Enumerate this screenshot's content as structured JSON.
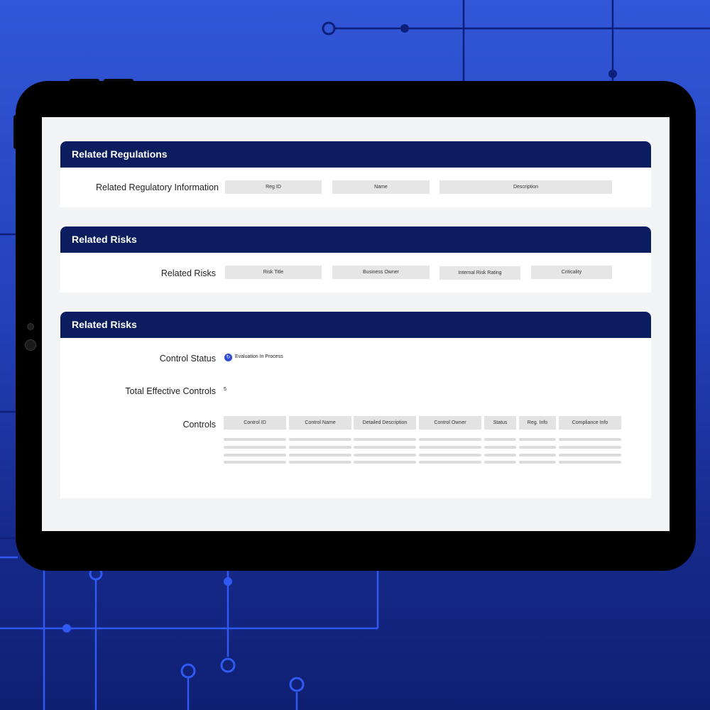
{
  "sections": {
    "regulations": {
      "title": "Related Regulations",
      "row_label": "Related Regulatory  Information",
      "columns": [
        "Reg ID",
        "Name",
        "Description"
      ]
    },
    "risks": {
      "title": "Related Risks",
      "row_label": "Related Risks",
      "columns": [
        "Risk Title",
        "Business Owner",
        "Internal Risk Rating",
        "Criticality"
      ]
    },
    "controls_section": {
      "title": "Related Risks",
      "control_status_label": "Control Status",
      "control_status_value": "Evaluation In Process",
      "total_label": "Total Effective Controls",
      "total_value": "5",
      "controls_label": "Controls",
      "columns": [
        "Control ID",
        "Control Name",
        "Detailed Description",
        "Control Owner",
        "Status",
        "Reg. Info",
        "Compliance Info"
      ]
    }
  },
  "icons": {
    "status": "progress-icon"
  },
  "colors": {
    "header": "#0b1d5e",
    "accent": "#2a49d6",
    "background": "#2340b8"
  }
}
